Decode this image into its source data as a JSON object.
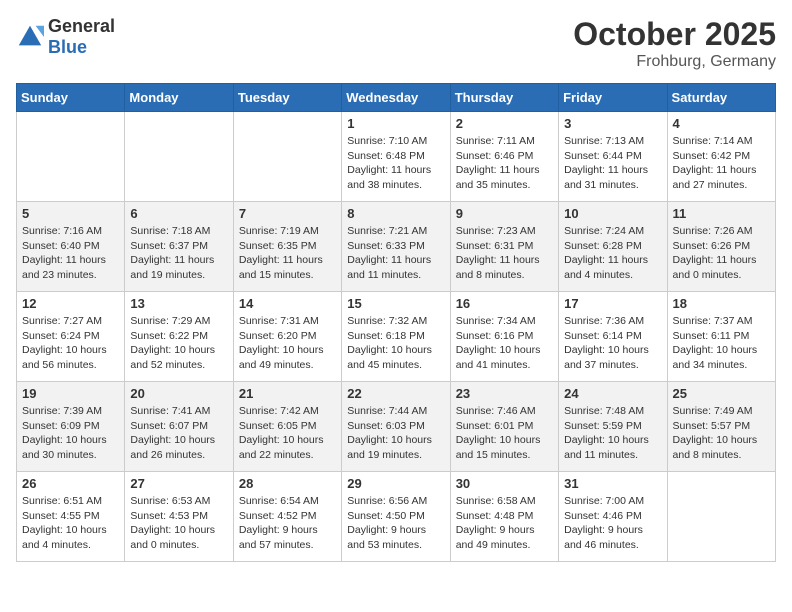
{
  "header": {
    "logo_general": "General",
    "logo_blue": "Blue",
    "month": "October 2025",
    "location": "Frohburg, Germany"
  },
  "days_of_week": [
    "Sunday",
    "Monday",
    "Tuesday",
    "Wednesday",
    "Thursday",
    "Friday",
    "Saturday"
  ],
  "weeks": [
    [
      {
        "day": "",
        "info": ""
      },
      {
        "day": "",
        "info": ""
      },
      {
        "day": "",
        "info": ""
      },
      {
        "day": "1",
        "info": "Sunrise: 7:10 AM\nSunset: 6:48 PM\nDaylight: 11 hours\nand 38 minutes."
      },
      {
        "day": "2",
        "info": "Sunrise: 7:11 AM\nSunset: 6:46 PM\nDaylight: 11 hours\nand 35 minutes."
      },
      {
        "day": "3",
        "info": "Sunrise: 7:13 AM\nSunset: 6:44 PM\nDaylight: 11 hours\nand 31 minutes."
      },
      {
        "day": "4",
        "info": "Sunrise: 7:14 AM\nSunset: 6:42 PM\nDaylight: 11 hours\nand 27 minutes."
      }
    ],
    [
      {
        "day": "5",
        "info": "Sunrise: 7:16 AM\nSunset: 6:40 PM\nDaylight: 11 hours\nand 23 minutes."
      },
      {
        "day": "6",
        "info": "Sunrise: 7:18 AM\nSunset: 6:37 PM\nDaylight: 11 hours\nand 19 minutes."
      },
      {
        "day": "7",
        "info": "Sunrise: 7:19 AM\nSunset: 6:35 PM\nDaylight: 11 hours\nand 15 minutes."
      },
      {
        "day": "8",
        "info": "Sunrise: 7:21 AM\nSunset: 6:33 PM\nDaylight: 11 hours\nand 11 minutes."
      },
      {
        "day": "9",
        "info": "Sunrise: 7:23 AM\nSunset: 6:31 PM\nDaylight: 11 hours\nand 8 minutes."
      },
      {
        "day": "10",
        "info": "Sunrise: 7:24 AM\nSunset: 6:28 PM\nDaylight: 11 hours\nand 4 minutes."
      },
      {
        "day": "11",
        "info": "Sunrise: 7:26 AM\nSunset: 6:26 PM\nDaylight: 11 hours\nand 0 minutes."
      }
    ],
    [
      {
        "day": "12",
        "info": "Sunrise: 7:27 AM\nSunset: 6:24 PM\nDaylight: 10 hours\nand 56 minutes."
      },
      {
        "day": "13",
        "info": "Sunrise: 7:29 AM\nSunset: 6:22 PM\nDaylight: 10 hours\nand 52 minutes."
      },
      {
        "day": "14",
        "info": "Sunrise: 7:31 AM\nSunset: 6:20 PM\nDaylight: 10 hours\nand 49 minutes."
      },
      {
        "day": "15",
        "info": "Sunrise: 7:32 AM\nSunset: 6:18 PM\nDaylight: 10 hours\nand 45 minutes."
      },
      {
        "day": "16",
        "info": "Sunrise: 7:34 AM\nSunset: 6:16 PM\nDaylight: 10 hours\nand 41 minutes."
      },
      {
        "day": "17",
        "info": "Sunrise: 7:36 AM\nSunset: 6:14 PM\nDaylight: 10 hours\nand 37 minutes."
      },
      {
        "day": "18",
        "info": "Sunrise: 7:37 AM\nSunset: 6:11 PM\nDaylight: 10 hours\nand 34 minutes."
      }
    ],
    [
      {
        "day": "19",
        "info": "Sunrise: 7:39 AM\nSunset: 6:09 PM\nDaylight: 10 hours\nand 30 minutes."
      },
      {
        "day": "20",
        "info": "Sunrise: 7:41 AM\nSunset: 6:07 PM\nDaylight: 10 hours\nand 26 minutes."
      },
      {
        "day": "21",
        "info": "Sunrise: 7:42 AM\nSunset: 6:05 PM\nDaylight: 10 hours\nand 22 minutes."
      },
      {
        "day": "22",
        "info": "Sunrise: 7:44 AM\nSunset: 6:03 PM\nDaylight: 10 hours\nand 19 minutes."
      },
      {
        "day": "23",
        "info": "Sunrise: 7:46 AM\nSunset: 6:01 PM\nDaylight: 10 hours\nand 15 minutes."
      },
      {
        "day": "24",
        "info": "Sunrise: 7:48 AM\nSunset: 5:59 PM\nDaylight: 10 hours\nand 11 minutes."
      },
      {
        "day": "25",
        "info": "Sunrise: 7:49 AM\nSunset: 5:57 PM\nDaylight: 10 hours\nand 8 minutes."
      }
    ],
    [
      {
        "day": "26",
        "info": "Sunrise: 6:51 AM\nSunset: 4:55 PM\nDaylight: 10 hours\nand 4 minutes."
      },
      {
        "day": "27",
        "info": "Sunrise: 6:53 AM\nSunset: 4:53 PM\nDaylight: 10 hours\nand 0 minutes."
      },
      {
        "day": "28",
        "info": "Sunrise: 6:54 AM\nSunset: 4:52 PM\nDaylight: 9 hours\nand 57 minutes."
      },
      {
        "day": "29",
        "info": "Sunrise: 6:56 AM\nSunset: 4:50 PM\nDaylight: 9 hours\nand 53 minutes."
      },
      {
        "day": "30",
        "info": "Sunrise: 6:58 AM\nSunset: 4:48 PM\nDaylight: 9 hours\nand 49 minutes."
      },
      {
        "day": "31",
        "info": "Sunrise: 7:00 AM\nSunset: 4:46 PM\nDaylight: 9 hours\nand 46 minutes."
      },
      {
        "day": "",
        "info": ""
      }
    ]
  ]
}
